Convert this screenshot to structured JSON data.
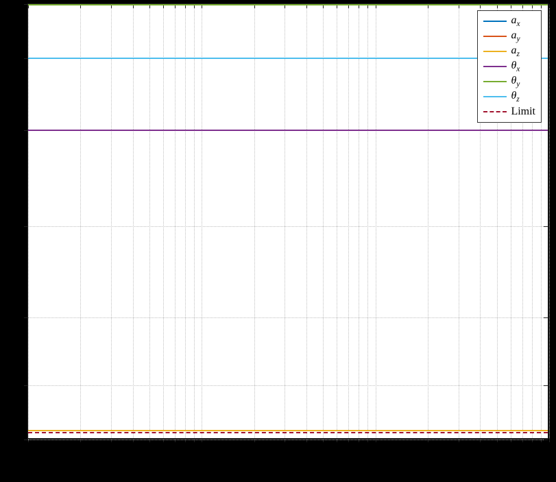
{
  "chart_data": {
    "type": "line",
    "title": "",
    "xlabel": "",
    "ylabel": "",
    "xlim": [
      0,
      1
    ],
    "ylim": [
      0,
      1
    ],
    "y_major_ticks": [
      0,
      0.125,
      0.28,
      0.49,
      0.71,
      0.875,
      1.0
    ],
    "x_minor_ticks_count": 29,
    "series": [
      {
        "name": "a_x",
        "label_html": "a<sub>x</sub>",
        "color": "#0072bd",
        "style": "solid",
        "value": 0.02
      },
      {
        "name": "a_y",
        "label_html": "a<sub>y</sub>",
        "color": "#d95319",
        "style": "solid",
        "value": 0.02
      },
      {
        "name": "a_z",
        "label_html": "a<sub>z</sub>",
        "color": "#edb120",
        "style": "solid",
        "value": 0.02
      },
      {
        "name": "theta_x",
        "label_html": "θ<sub>x</sub>",
        "color": "#7e2f8e",
        "style": "solid",
        "value": 0.71
      },
      {
        "name": "theta_y",
        "label_html": "θ<sub>y</sub>",
        "color": "#77ac30",
        "style": "solid",
        "value": 1.0
      },
      {
        "name": "theta_z",
        "label_html": "θ<sub>z</sub>",
        "color": "#4dbeee",
        "style": "solid",
        "value": 0.875
      },
      {
        "name": "Limit",
        "label_html": "Limit",
        "color": "#a2142f",
        "style": "dashed",
        "value": 0.015
      }
    ],
    "legend_position": "top-right"
  }
}
